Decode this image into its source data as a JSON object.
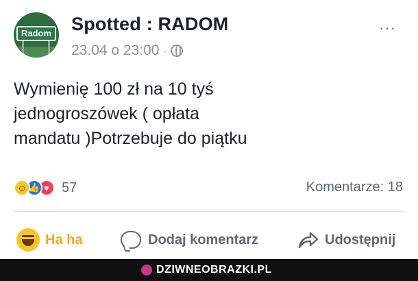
{
  "post": {
    "page_name": "Spotted : RADOM",
    "avatar_text": "Radom",
    "timestamp": "23.04 o 23:00",
    "separator": "·",
    "privacy_icon": "globe-icon",
    "more_icon": "more-options-icon",
    "more_glyph": "···",
    "text": "Wymienię 100 zł na 10 tyś\njednogroszówek ( opłata\nmandatu )Potrzebuje do piątku"
  },
  "stats": {
    "reaction_icons": [
      "haha-icon",
      "like-icon",
      "love-icon"
    ],
    "reaction_count": "57",
    "comments_label": "Komentarze: 18"
  },
  "actions": {
    "haha_label": "Ha ha",
    "comment_label": "Dodaj komentarz",
    "share_label": "Udostępnij"
  },
  "watermark": {
    "text": "DZIWNEOBRAZKI.PL"
  },
  "colors": {
    "haha_accent": "#f0a822",
    "muted_text": "#606770",
    "like_blue": "#1877f2",
    "love_red": "#f33e58"
  }
}
